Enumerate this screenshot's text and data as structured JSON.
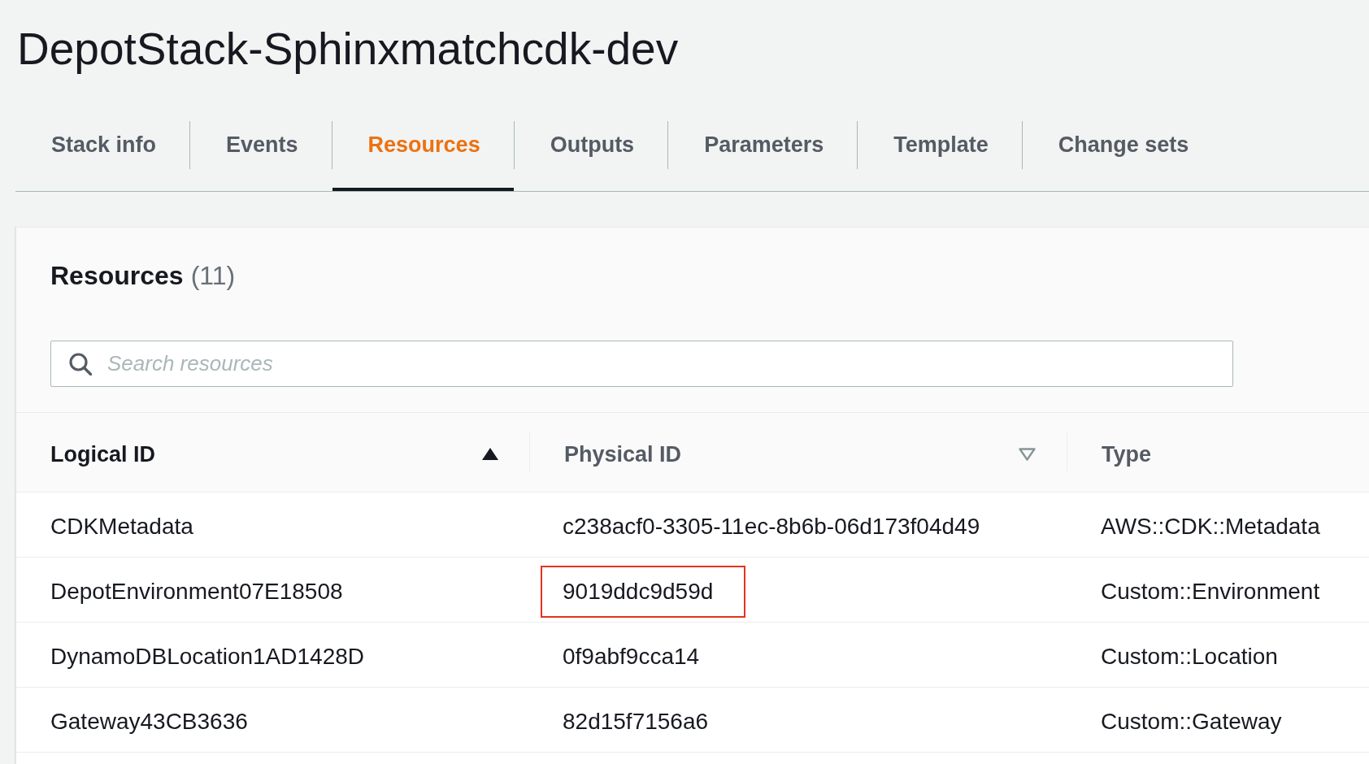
{
  "page": {
    "title": "DepotStack-Sphinxmatchcdk-dev"
  },
  "tabs": [
    {
      "label": "Stack info",
      "selected": false
    },
    {
      "label": "Events",
      "selected": false
    },
    {
      "label": "Resources",
      "selected": true
    },
    {
      "label": "Outputs",
      "selected": false
    },
    {
      "label": "Parameters",
      "selected": false
    },
    {
      "label": "Template",
      "selected": false
    },
    {
      "label": "Change sets",
      "selected": false
    }
  ],
  "resources_panel": {
    "heading": "Resources",
    "count": "(11)",
    "search": {
      "placeholder": "Search resources"
    },
    "table": {
      "columns": [
        {
          "label": "Logical ID",
          "sortable": true,
          "sorted": true
        },
        {
          "label": "Physical ID",
          "sortable": true,
          "sorted": false
        },
        {
          "label": "Type",
          "sortable": false,
          "sorted": false
        }
      ],
      "rows": [
        {
          "logical_id": "CDKMetadata",
          "physical_id": "c238acf0-3305-11ec-8b6b-06d173f04d49",
          "type": "AWS::CDK::Metadata",
          "highlighted": false
        },
        {
          "logical_id": "DepotEnvironment07E18508",
          "physical_id": "9019ddc9d59d",
          "type": "Custom::Environment",
          "highlighted": true
        },
        {
          "logical_id": "DynamoDBLocation1AD1428D",
          "physical_id": "0f9abf9cca14",
          "type": "Custom::Location",
          "highlighted": false
        },
        {
          "logical_id": "Gateway43CB3636",
          "physical_id": "82d15f7156a6",
          "type": "Custom::Gateway",
          "highlighted": false
        }
      ]
    }
  }
}
